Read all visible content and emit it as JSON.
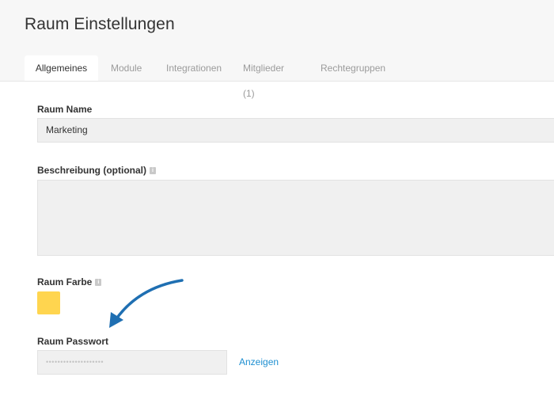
{
  "header": {
    "title": "Raum Einstellungen"
  },
  "tabs": [
    {
      "label": "Allgemeines",
      "active": true
    },
    {
      "label": "Module",
      "active": false
    },
    {
      "label": "Integrationen",
      "active": false
    },
    {
      "label": "Mitglieder (1)",
      "active": false
    },
    {
      "label": "Rechtegruppen",
      "active": false
    }
  ],
  "form": {
    "name_label": "Raum Name",
    "name_value": "Marketing",
    "description_label": "Beschreibung (optional)",
    "description_value": "",
    "color_label": "Raum Farbe",
    "color_value": "#ffd54f",
    "password_label": "Raum Passwort",
    "password_masked": "••••••••••••••••••••",
    "show_label": "Anzeigen"
  },
  "icons": {
    "info": "info-icon",
    "annotation_arrow": "curved-arrow-icon"
  },
  "colors": {
    "accent": "#1e8fd1",
    "arrow": "#1f6fb2",
    "swatch": "#ffd54f"
  }
}
